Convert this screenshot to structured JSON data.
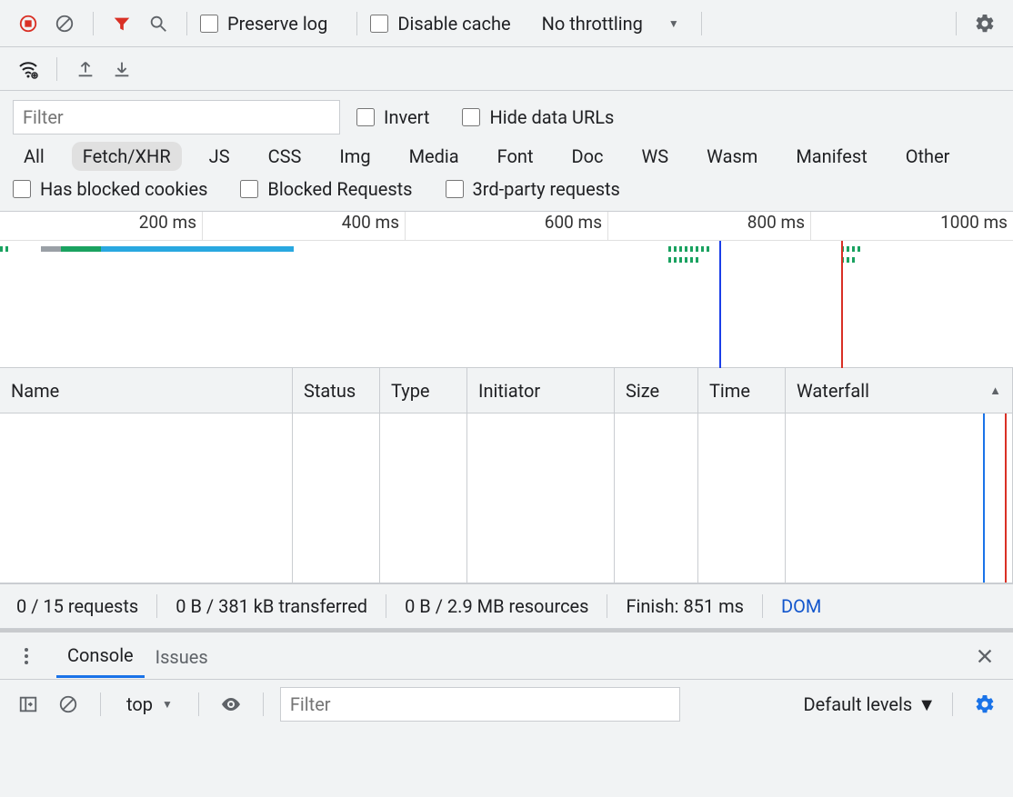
{
  "toolbar": {
    "preserve_log": "Preserve log",
    "disable_cache": "Disable cache",
    "throttling": "No throttling"
  },
  "filter": {
    "placeholder": "Filter",
    "invert": "Invert",
    "hide_data_urls": "Hide data URLs",
    "types": [
      "All",
      "Fetch/XHR",
      "JS",
      "CSS",
      "Img",
      "Media",
      "Font",
      "Doc",
      "WS",
      "Wasm",
      "Manifest",
      "Other"
    ],
    "active_type_index": 1,
    "has_blocked_cookies": "Has blocked cookies",
    "blocked_requests": "Blocked Requests",
    "third_party": "3rd-party requests"
  },
  "overview": {
    "ticks": [
      "200 ms",
      "400 ms",
      "600 ms",
      "800 ms",
      "1000 ms"
    ]
  },
  "columns": {
    "name": "Name",
    "status": "Status",
    "type": "Type",
    "initiator": "Initiator",
    "size": "Size",
    "time": "Time",
    "waterfall": "Waterfall"
  },
  "status": {
    "requests": "0 / 15 requests",
    "transferred": "0 B / 381 kB transferred",
    "resources": "0 B / 2.9 MB resources",
    "finish": "Finish: 851 ms",
    "dom": "DOM"
  },
  "drawer": {
    "tabs": {
      "console": "Console",
      "issues": "Issues"
    },
    "context": "top",
    "filter_placeholder": "Filter",
    "levels": "Default levels"
  }
}
